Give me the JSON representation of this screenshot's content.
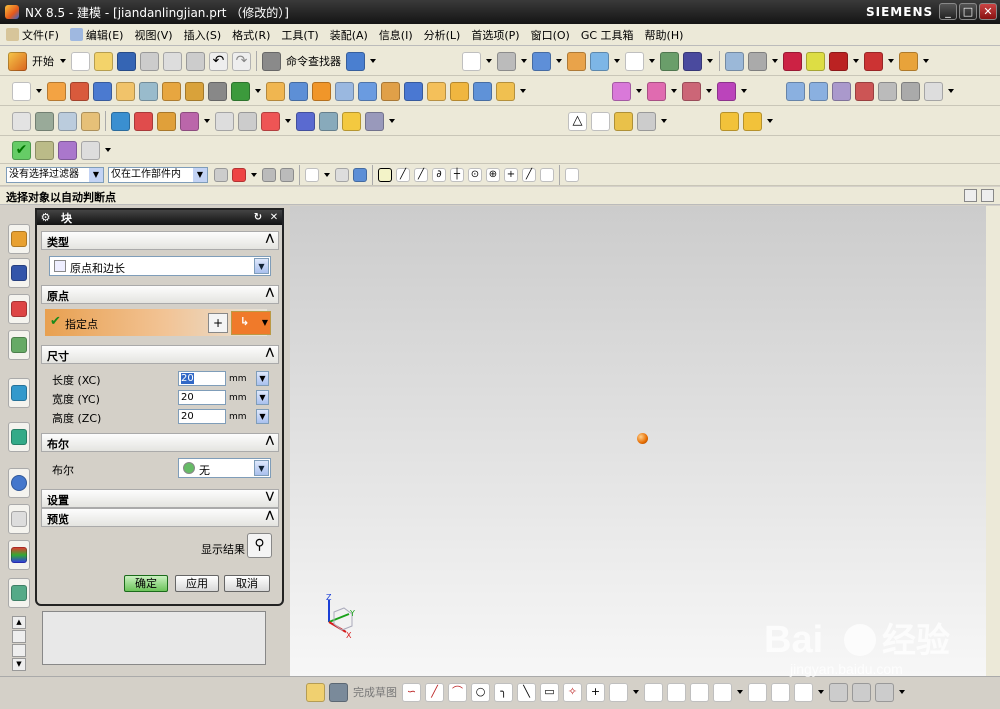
{
  "window": {
    "title": "NX 8.5 - 建模 - [jiandanlingjian.prt （修改的）]",
    "brand": "SIEMENS"
  },
  "menu": [
    "文件(F)",
    "编辑(E)",
    "视图(V)",
    "插入(S)",
    "格式(R)",
    "工具(T)",
    "装配(A)",
    "信息(I)",
    "分析(L)",
    "首选项(P)",
    "窗口(O)",
    "GC 工具箱",
    "帮助(H)"
  ],
  "toolbar": {
    "start_label": "开始",
    "cmd_finder_label": "命令查找器"
  },
  "selection": {
    "filter": "没有选择过滤器",
    "scope": "仅在工作部件内"
  },
  "status": {
    "prompt": "选择对象以自动判断点"
  },
  "dialog": {
    "title": "块",
    "type_section": "类型",
    "type_value": "原点和边长",
    "origin_section": "原点",
    "specify_point": "指定点",
    "dims_section": "尺寸",
    "length_label": "长度 (XC)",
    "length_value": "20",
    "width_label": "宽度 (YC)",
    "width_value": "20",
    "height_label": "高度 (ZC)",
    "height_value": "20",
    "unit": "mm",
    "bool_section": "布尔",
    "bool_label": "布尔",
    "bool_value": "无",
    "settings_section": "设置",
    "preview_section": "预览",
    "show_result": "显示结果",
    "ok": "确定",
    "apply": "应用",
    "cancel": "取消"
  },
  "bottom": {
    "finish_sketch": "完成草图"
  },
  "watermark": {
    "brand": "Bai",
    "cn": "经验",
    "url": "jingyan.baidu.com"
  },
  "triad": {
    "z": "Z",
    "y": "Y",
    "x": "X"
  }
}
